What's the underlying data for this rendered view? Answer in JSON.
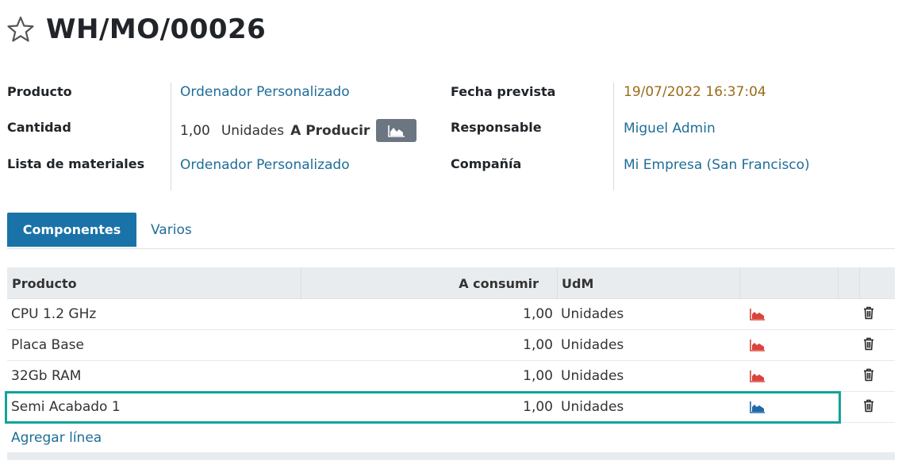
{
  "header": {
    "title": "WH/MO/00026",
    "star_icon": "star-icon"
  },
  "fields": {
    "product_label": "Producto",
    "product_value": "Ordenador Personalizado",
    "quantity_label": "Cantidad",
    "quantity_value": "1,00",
    "quantity_unit": "Unidades",
    "quantity_suffix": "A Producir",
    "bom_label": "Lista de materiales",
    "bom_value": "Ordenador Personalizado",
    "date_label": "Fecha prevista",
    "date_value": "19/07/2022 16:37:04",
    "responsible_label": "Responsable",
    "responsible_value": "Miguel Admin",
    "company_label": "Compañía",
    "company_value": "Mi Empresa (San Francisco)"
  },
  "tabs": [
    {
      "label": "Componentes",
      "active": true
    },
    {
      "label": "Varios",
      "active": false
    }
  ],
  "table": {
    "headers": {
      "product": "Producto",
      "to_consume": "A consumir",
      "uom": "UdM"
    },
    "rows": [
      {
        "product": "CPU 1.2 GHz",
        "to_consume": "1,00",
        "uom": "Unidades",
        "forecast_status": "unavailable"
      },
      {
        "product": "Placa Base",
        "to_consume": "1,00",
        "uom": "Unidades",
        "forecast_status": "unavailable"
      },
      {
        "product": "32Gb RAM",
        "to_consume": "1,00",
        "uom": "Unidades",
        "forecast_status": "unavailable"
      },
      {
        "product": "Semi Acabado 1",
        "to_consume": "1,00",
        "uom": "Unidades",
        "forecast_status": "available"
      }
    ],
    "add_line": "Agregar línea"
  },
  "colors": {
    "link": "#1f6d97",
    "accent": "#1a73a8",
    "date": "#9b6b1a",
    "forecast_unavailable": "#d9443c",
    "forecast_available": "#1f6aa8",
    "highlight": "#12a39c"
  }
}
